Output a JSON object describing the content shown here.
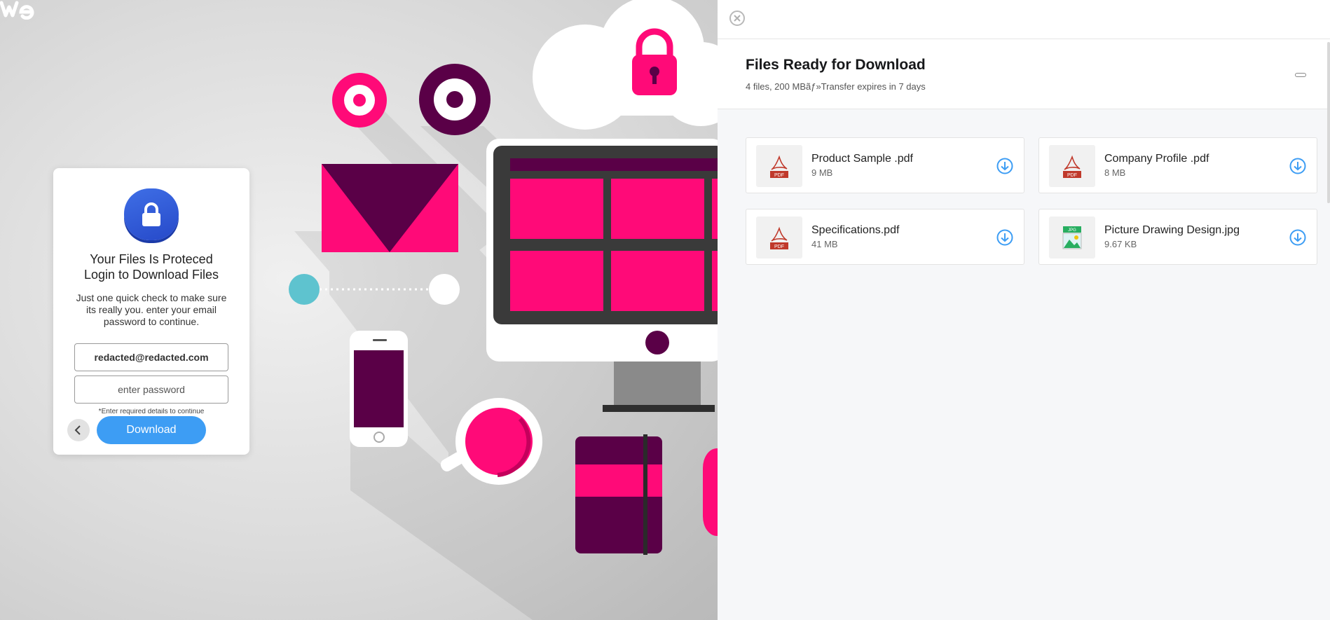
{
  "brand": {
    "logo_icon": "wetransfer-logo-icon"
  },
  "login": {
    "title_line1": "Your Files Is Proteced",
    "title_line2": "Login to Download Files",
    "subtitle": "Just one quick check to make sure its really you. enter your email password to continue.",
    "email_value": "redacted@redacted.com",
    "password_placeholder": "enter password",
    "required_note": "*Enter required details to continue",
    "download_label": "Download",
    "back_icon": "chevron-left-icon",
    "lock_icon": "lock-icon"
  },
  "panel": {
    "title": "Files Ready for Download",
    "meta": "4 files, 200 MBãƒ»Transfer expires in 7 days",
    "close_icon": "close-icon",
    "files": [
      {
        "name": "Product Sample .pdf",
        "size": "9 MB",
        "type_label": "PDF",
        "icon": "pdf-file-icon"
      },
      {
        "name": "Company Profile .pdf",
        "size": "8 MB",
        "type_label": "PDF",
        "icon": "pdf-file-icon"
      },
      {
        "name": "Specifications.pdf",
        "size": "41 MB",
        "type_label": "PDF",
        "icon": "pdf-file-icon"
      },
      {
        "name": "Picture Drawing Design.jpg",
        "size": "9.67 KB",
        "type_label": "JPG",
        "icon": "image-file-icon"
      }
    ]
  },
  "colors": {
    "accent_blue": "#3d9df4",
    "magenta": "#ff0a78",
    "plum": "#5a0047",
    "lock_blue": "#2649c9",
    "pdf_red": "#c0392b"
  }
}
